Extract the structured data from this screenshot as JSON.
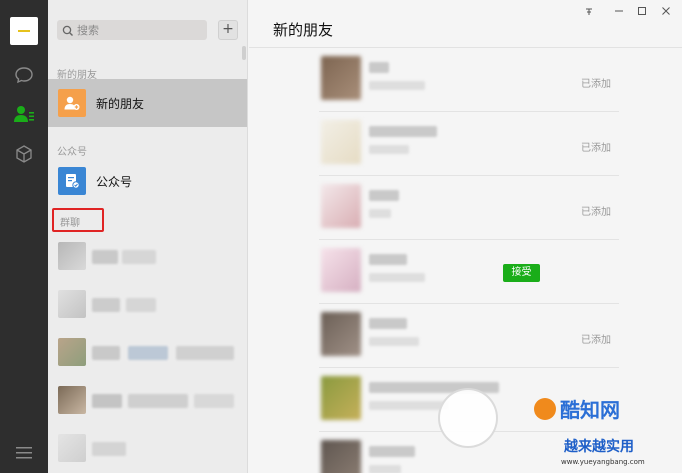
{
  "colors": {
    "nav_bg": "#2e2e2e",
    "list_bg": "#ececec",
    "selected_row": "#c6c6c6",
    "accent_green": "#1aad19",
    "highlight_red": "#e02424"
  },
  "nav": {
    "items": [
      {
        "icon": "chat-bubble-icon",
        "active": false
      },
      {
        "icon": "contacts-icon",
        "active": true
      },
      {
        "icon": "cube-icon",
        "active": false
      },
      {
        "icon": "menu-icon",
        "active": false
      }
    ]
  },
  "search": {
    "placeholder": "搜索",
    "add_label": "+"
  },
  "contacts": {
    "new_friends_section": "新的朋友",
    "new_friends_item": "新的朋友",
    "official_section": "公众号",
    "official_item": "公众号",
    "groups_section": "群聊"
  },
  "main": {
    "title": "新的朋友",
    "window_controls": [
      "pin-icon",
      "minimize-icon",
      "maximize-icon",
      "close-icon"
    ],
    "requests": [
      {
        "status": "已添加"
      },
      {
        "status": "已添加"
      },
      {
        "status": "已添加"
      },
      {
        "action": "接受"
      },
      {
        "status": "已添加"
      }
    ]
  },
  "watermark": {
    "name": "酷知网",
    "slogan": "越来越实用",
    "url": "www.yueyangbang.com"
  }
}
